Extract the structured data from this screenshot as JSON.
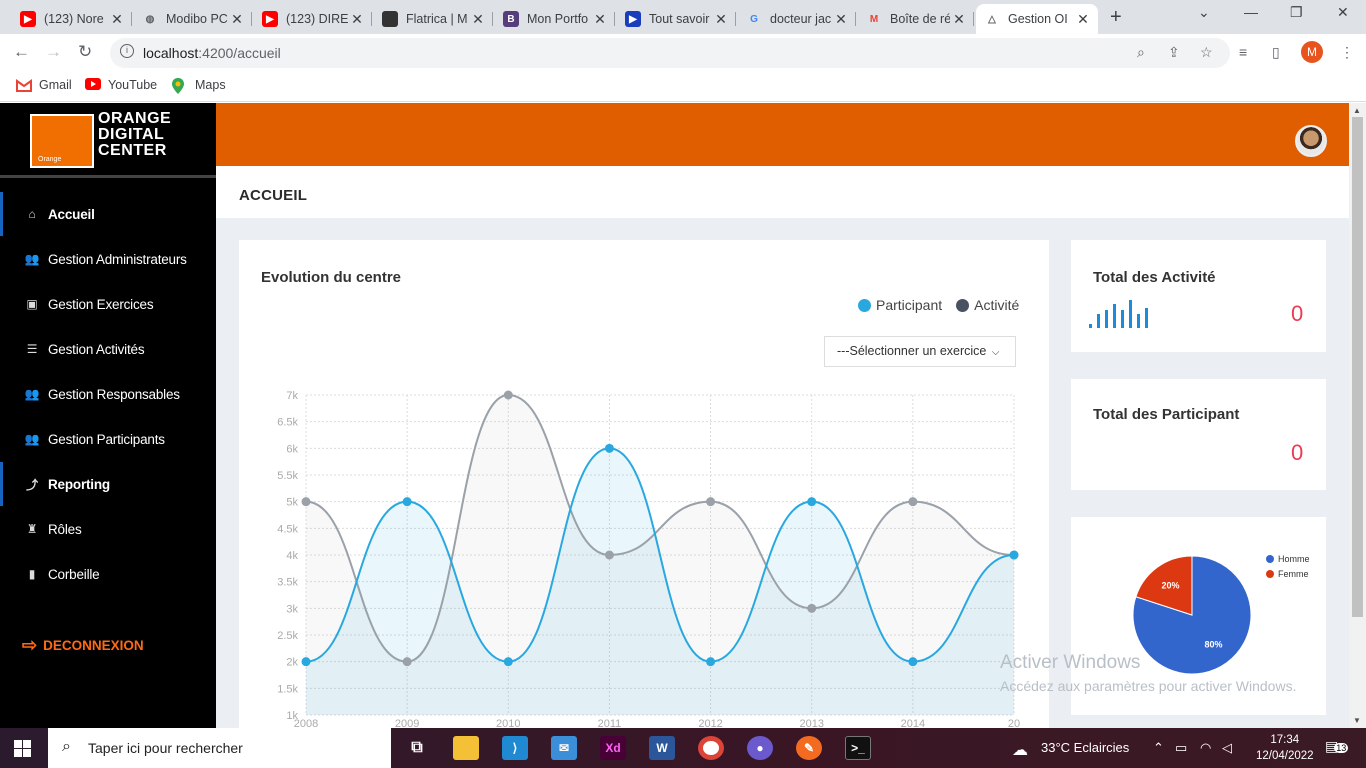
{
  "browser": {
    "tabs": [
      {
        "title": "(123) Nore",
        "icon": "youtube-icon",
        "color": "#ff0000"
      },
      {
        "title": "Modibo PC",
        "icon": "globe-icon",
        "color": "#5f6368"
      },
      {
        "title": "(123) DIRE",
        "icon": "youtube-icon",
        "color": "#ff0000"
      },
      {
        "title": "Flatrica | M",
        "icon": "flatrica-icon",
        "color": "#333333"
      },
      {
        "title": "Mon Portfo",
        "icon": "bootstrap-icon",
        "color": "#563d7c"
      },
      {
        "title": "Tout savoir",
        "icon": "play-icon",
        "color": "#1a3ebb"
      },
      {
        "title": "docteur jac",
        "icon": "google-icon",
        "color": "#4285f4"
      },
      {
        "title": "Boîte de ré",
        "icon": "gmail-icon",
        "color": "#ea4335"
      },
      {
        "title": "Gestion OI",
        "icon": "angular-icon",
        "color": "#5f6368"
      }
    ],
    "url_host": "localhost",
    "url_path": ":4200/accueil",
    "profile_initial": "M",
    "bookmarks": [
      {
        "label": "Gmail",
        "icon": "gmail-icon"
      },
      {
        "label": "YouTube",
        "icon": "youtube-icon"
      },
      {
        "label": "Maps",
        "icon": "maps-icon"
      }
    ]
  },
  "app": {
    "logo": {
      "line1": "ORANGE",
      "line2": "DIGITAL",
      "line3": "CENTER",
      "brand": "Orange"
    },
    "nav": [
      {
        "label": "Accueil",
        "icon": "home-icon",
        "active": true
      },
      {
        "label": "Gestion Administrateurs",
        "icon": "users-icon",
        "active": false
      },
      {
        "label": "Gestion Exercices",
        "icon": "calendar-check-icon",
        "active": false
      },
      {
        "label": "Gestion Activités",
        "icon": "list-icon",
        "active": false
      },
      {
        "label": "Gestion Responsables",
        "icon": "users-icon",
        "active": false
      },
      {
        "label": "Gestion Participants",
        "icon": "users-icon",
        "active": false
      },
      {
        "label": "Reporting",
        "icon": "chart-line-icon",
        "active": true
      },
      {
        "label": "Rôles",
        "icon": "user-role-icon",
        "active": false
      },
      {
        "label": "Corbeille",
        "icon": "trash-icon",
        "active": false
      }
    ],
    "logout_label": "DECONNEXION",
    "page_title": "ACCUEIL",
    "evolution": {
      "title": "Evolution du centre",
      "select_placeholder": "---Sélectionner un exercice"
    },
    "stats": {
      "activities_title": "Total des Activité",
      "activities_value": "0",
      "participants_title": "Total des Participant",
      "participants_value": "0"
    }
  },
  "colors": {
    "primary_orange": "#e05d00",
    "participant_blue": "#29a8e0",
    "activity_gray": "#9aa1a9",
    "stat_red": "#ea3c53"
  },
  "chart_data": [
    {
      "type": "line",
      "title": "Evolution du centre",
      "x": [
        "2008",
        "2009",
        "2010",
        "2011",
        "2012",
        "2013",
        "2014",
        "20"
      ],
      "series": [
        {
          "name": "Participant",
          "values": [
            2000,
            5000,
            2000,
            6000,
            2000,
            5000,
            2000,
            4000
          ]
        },
        {
          "name": "Activité",
          "values": [
            5000,
            2000,
            7000,
            4000,
            5000,
            3000,
            5000,
            4000
          ]
        }
      ],
      "y_ticks": [
        "1k",
        "1.5k",
        "2k",
        "2.5k",
        "3k",
        "3.5k",
        "4k",
        "4.5k",
        "5k",
        "5.5k",
        "6k",
        "6.5k",
        "7k"
      ],
      "ylim": [
        1000,
        7000
      ],
      "grid": true,
      "legend": "top-right"
    },
    {
      "type": "pie",
      "labels": [
        "Homme",
        "Femme"
      ],
      "values": [
        80,
        20
      ],
      "data_labels": [
        "80%",
        "20%"
      ],
      "colors": [
        "#3366cc",
        "#dc3912"
      ],
      "legend": "right"
    }
  ],
  "watermark": {
    "line1": "Activer Windows",
    "line2": "Accédez aux paramètres pour activer Windows."
  },
  "taskbar": {
    "search_placeholder": "Taper ici pour rechercher",
    "weather": "33°C  Eclaircies",
    "time": "17:34",
    "date": "12/04/2022",
    "notif_count": "13"
  }
}
